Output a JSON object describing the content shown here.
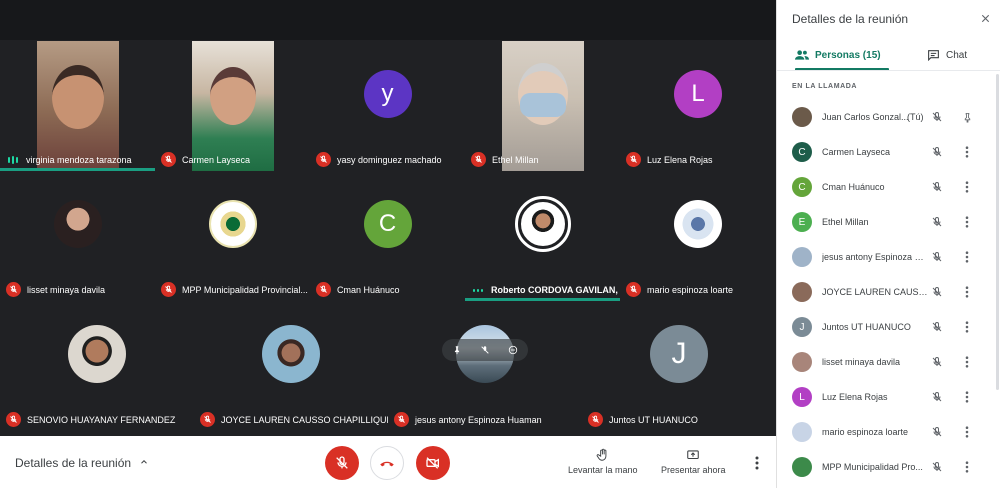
{
  "tiles": [
    {
      "name": "virginia mendoza tarazona",
      "mic": "speaking"
    },
    {
      "name": "Carmen Layseca",
      "mic": "muted"
    },
    {
      "name": "yasy dominguez machado",
      "mic": "muted",
      "initial": "y",
      "color": "#5c35c4"
    },
    {
      "name": "Ethel Millan",
      "mic": "muted"
    },
    {
      "name": "Luz Elena Rojas",
      "mic": "muted",
      "initial": "L",
      "color": "#b23fc4"
    },
    {
      "name": "lisset minaya davila",
      "mic": "muted"
    },
    {
      "name": "MPP Municipalidad Provincial...",
      "mic": "muted"
    },
    {
      "name": "Cman Huánuco",
      "mic": "muted",
      "initial": "C",
      "color": "#64a53a"
    },
    {
      "name": "Roberto CORDOVA GAVILAN,",
      "mic": "dots"
    },
    {
      "name": "mario espinoza loarte",
      "mic": "muted"
    },
    {
      "name": "SENOVIO HUAYANAY FERNANDEZ",
      "mic": "muted"
    },
    {
      "name": "JOYCE LAUREN CAUSSO CHAPILLIQUEN",
      "mic": "muted"
    },
    {
      "name": "jesus antony Espinoza Huaman",
      "mic": "muted"
    },
    {
      "name": "Juntos UT HUANUCO",
      "mic": "muted",
      "initial": "J",
      "color": "#7b8b96"
    }
  ],
  "bottombar": {
    "meeting_details": "Detalles de la reunión",
    "raise_hand": "Levantar la mano",
    "present_now": "Presentar ahora"
  },
  "panel": {
    "title": "Detalles de la reunión",
    "tab_people": "Personas (15)",
    "tab_chat": "Chat",
    "section_header": "EN LA LLAMADA",
    "you_suffix": "(Tú)",
    "people": [
      {
        "name": "Juan Carlos Gonzal...",
        "you": true,
        "avatar": "photo",
        "color": "#6b5a4a",
        "icon": "pin-icon"
      },
      {
        "name": "Carmen Layseca",
        "avatar": "C",
        "color": "#1e5d4a"
      },
      {
        "name": "Cman Huánuco",
        "avatar": "C",
        "color": "#64a53a"
      },
      {
        "name": "Ethel Millan",
        "avatar": "E",
        "color": "#4caf50"
      },
      {
        "name": "jesus antony Espinoza H...",
        "avatar": "photo",
        "color": "#9fb3c8"
      },
      {
        "name": "JOYCE LAUREN CAUSS...",
        "avatar": "photo",
        "color": "#8a6a5a"
      },
      {
        "name": "Juntos UT HUANUCO",
        "avatar": "J",
        "color": "#7b8b96"
      },
      {
        "name": "lisset minaya davila",
        "avatar": "photo",
        "color": "#a8857a"
      },
      {
        "name": "Luz Elena Rojas",
        "avatar": "L",
        "color": "#b23fc4"
      },
      {
        "name": "mario espinoza loarte",
        "avatar": "photo",
        "color": "#c8d4e6"
      },
      {
        "name": "MPP Municipalidad Pro...",
        "avatar": "photo",
        "color": "#3c8a4a"
      }
    ]
  }
}
